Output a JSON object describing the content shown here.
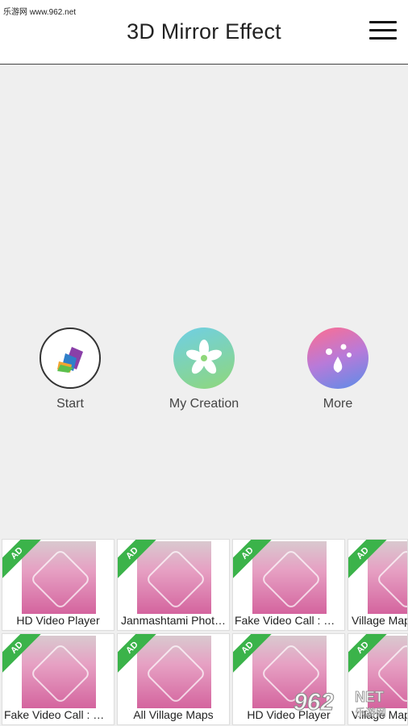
{
  "watermark_top": "乐游网 www.962.net",
  "header": {
    "title": "3D Mirror Effect",
    "menu_icon": "hamburger-menu-icon"
  },
  "actions": [
    {
      "label": "Start",
      "icon": "layers-icon"
    },
    {
      "label": "My Creation",
      "icon": "flower-icon"
    },
    {
      "label": "More",
      "icon": "drops-icon"
    }
  ],
  "ads": {
    "badge": "AD",
    "row1": [
      "HD Video Player",
      "Janmashtami Phot…",
      "Fake Video Call : Gi…",
      "Village Maps"
    ],
    "row2": [
      "Fake Video Call : Gi…",
      "All Village Maps",
      "HD Video Player",
      "Village Maps"
    ]
  },
  "watermark_bottom": {
    "logo": "962",
    "net": "NET",
    "site": "乐游网"
  },
  "colors": {
    "ad_badge": "#3bb34a",
    "header_bg": "#ffffff",
    "page_bg": "#efefef"
  }
}
